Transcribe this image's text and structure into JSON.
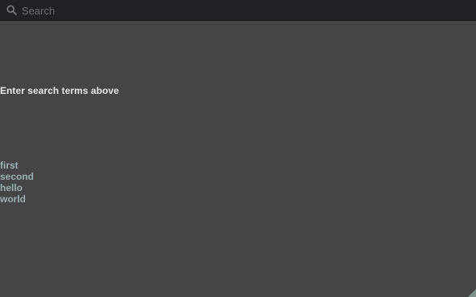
{
  "search": {
    "placeholder": "Search",
    "value": ""
  },
  "main": {
    "prompt": "Enter search terms above",
    "terms": [
      "first",
      "second",
      "hello",
      "world"
    ]
  },
  "icons": {
    "search": "search-icon",
    "resize": "resize-grip-icon"
  },
  "colors": {
    "background": "#454545",
    "search_bar": "#202124",
    "prompt_text": "#e9e9e9",
    "term_text": "#9db0b6",
    "placeholder": "#6c6e72"
  }
}
